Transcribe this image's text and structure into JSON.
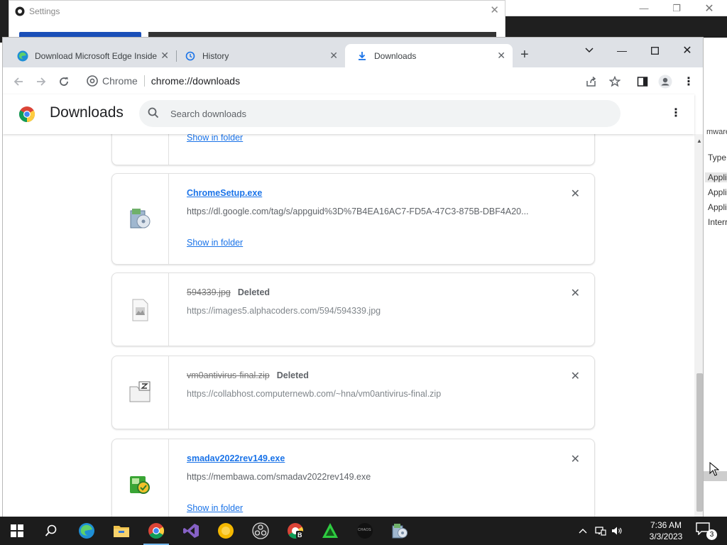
{
  "background": {
    "settings_window": {
      "title": "Settings"
    },
    "right_window": {
      "header_text": "mware",
      "column_header": "Type",
      "rows": [
        "Appli",
        "Appli",
        "Appli",
        "Interr"
      ]
    }
  },
  "browser": {
    "tabs": [
      {
        "title": "Download Microsoft Edge Inside",
        "icon": "edge-icon",
        "active": false
      },
      {
        "title": "History",
        "icon": "history-icon",
        "active": false
      },
      {
        "title": "Downloads",
        "icon": "download-icon",
        "active": true
      }
    ],
    "omnibox": {
      "chip": "Chrome",
      "url": "chrome://downloads"
    }
  },
  "downloads_page": {
    "title": "Downloads",
    "search_placeholder": "Search downloads",
    "show_in_folder": "Show in folder",
    "items": [
      {
        "filename": "ChromeSetup.exe",
        "url": "https://dl.google.com/tag/s/appguid%3D%7B4EA16AC7-FD5A-47C3-875B-DBF4A20...",
        "status": "",
        "icon": "installer-icon"
      },
      {
        "filename": "594339.jpg",
        "url": "https://images5.alphacoders.com/594/594339.jpg",
        "status": "Deleted",
        "icon": "image-file-icon"
      },
      {
        "filename": "vm0antivirus-final.zip",
        "url": "https://collabhost.computernewb.com/~hna/vm0antivirus-final.zip",
        "status": "Deleted",
        "icon": "zip-file-icon"
      },
      {
        "filename": "smadav2022rev149.exe",
        "url": "https://membawa.com/smadav2022rev149.exe",
        "status": "",
        "icon": "smadav-icon"
      }
    ]
  },
  "taskbar": {
    "apps": [
      "start-icon",
      "search-icon",
      "edge-icon",
      "file-explorer-icon",
      "chrome-icon",
      "visual-studio-icon",
      "yellow-app-icon",
      "obs-icon",
      "chrome-beta-icon",
      "green-app-icon",
      "chaos-app-icon",
      "installer-icon"
    ],
    "chaos_label": "CHAOS",
    "clock_time": "7:36 AM",
    "clock_date": "3/3/2023",
    "notification_count": "3"
  }
}
